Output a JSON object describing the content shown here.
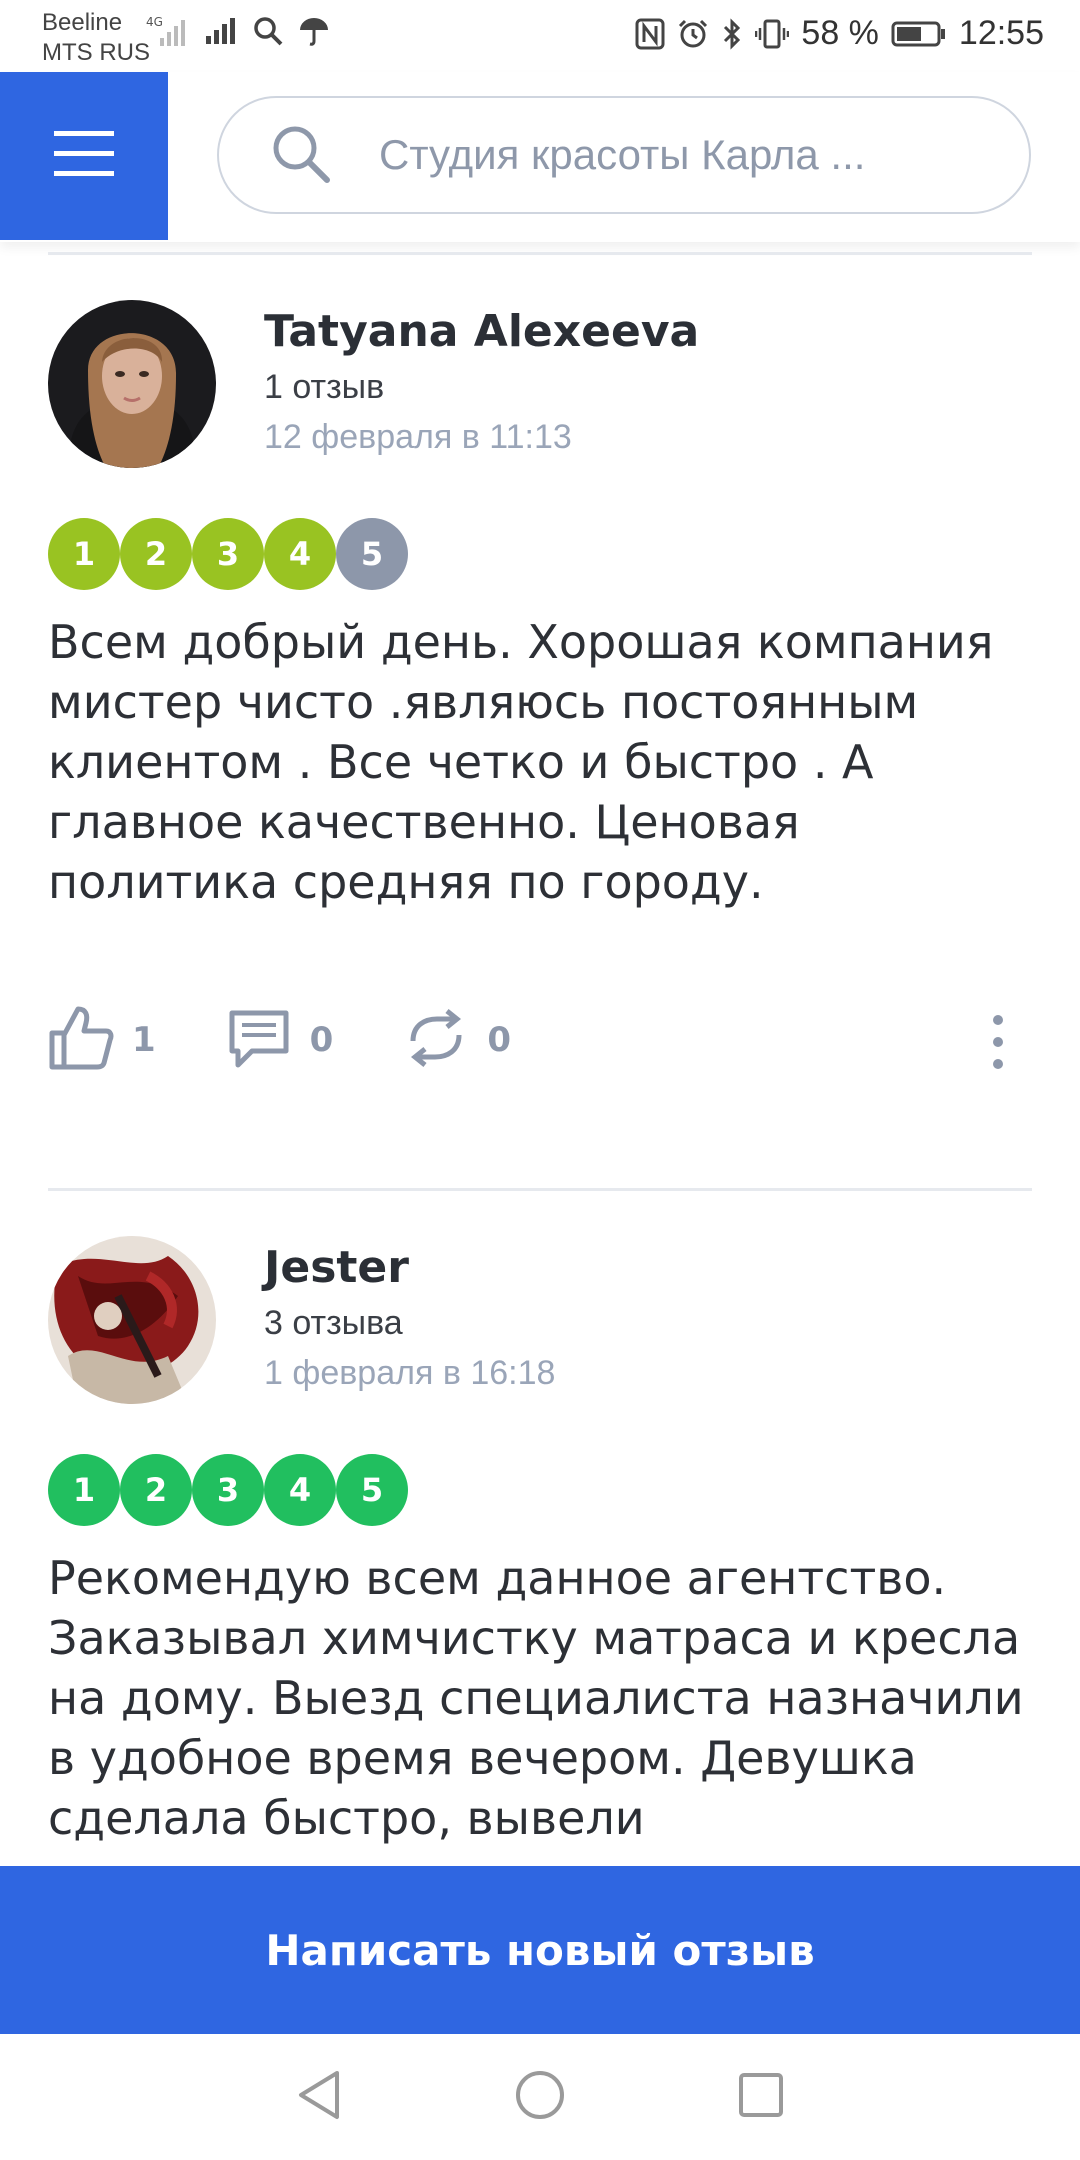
{
  "status_bar": {
    "carrier1": "Beeline",
    "carrier2": "MTS RUS",
    "network": "4G",
    "battery": "58 %",
    "time": "12:55"
  },
  "header": {
    "search_placeholder": "Студия красоты Карла ..."
  },
  "reviews": [
    {
      "author": "Tatyana Alexeeva",
      "count": "1 отзыв",
      "date": "12 февраля в 11:13",
      "rating": 4,
      "rating_labels": [
        "1",
        "2",
        "3",
        "4",
        "5"
      ],
      "text": "Всем добрый день. Хорошая компания мистер чисто .являюсь постоянным клиентом . Все четко и быстро . А главное качественно. Ценовая политика средняя по городу.",
      "likes": "1",
      "comments": "0",
      "reposts": "0"
    },
    {
      "author": "Jester",
      "count": "3 отзыва",
      "date": "1 февраля в 16:18",
      "rating": 5,
      "rating_labels": [
        "1",
        "2",
        "3",
        "4",
        "5"
      ],
      "text": "Рекомендую всем данное агентство. Заказывал химчистку матраса и кресла на дому. Выезд специалиста назначили в удобное время вечером. Девушка сделала быстро, вывели"
    }
  ],
  "cta": {
    "label": "Написать новый отзыв"
  },
  "colors": {
    "brand_blue": "#2f66e1",
    "rating_partial": "#99c322",
    "rating_empty": "#8d97aa",
    "rating_full": "#21bf5f"
  }
}
